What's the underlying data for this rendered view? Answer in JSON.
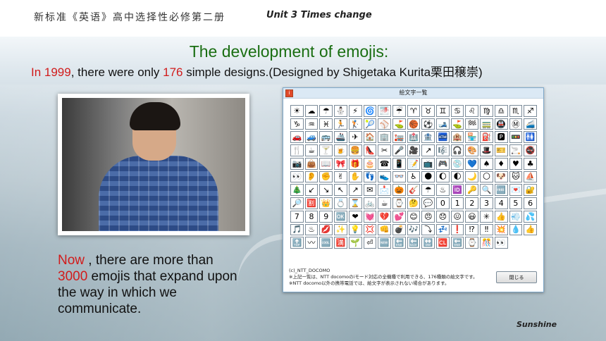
{
  "header": {
    "title": "新标准《英语》高中选择性必修第二册",
    "unit": "Unit 3 Times change"
  },
  "heading": "The development of emojis:",
  "subline": {
    "pre": "In 1999",
    "mid1": ",  there were only ",
    "count": "176",
    "mid2": " simple designs.(Designed by Shigetaka Kurita栗田穣崇)"
  },
  "now": {
    "word": "Now",
    "rest1": " , there are more than",
    "count": "3000",
    "rest2": " emojis that expand upon the way in which we communicate."
  },
  "footer": "Sunshine",
  "window": {
    "title": "絵文字一覧",
    "footnote1": "(c)_NTT_DOCOMO",
    "footnote2": "※上記一覧は、NTT docomoのiモード対応の全機種で利用できる、176種類の絵文字です。",
    "footnote3": "※NTT docomo以外の携帯電話では、絵文字が表示されない場合があります。",
    "close_label": "閉じる",
    "emojis": [
      "☀",
      "☁",
      "☂",
      "⛄",
      "⚡",
      "🌀",
      "🌁",
      "☔",
      "♈",
      "♉",
      "♊",
      "♋",
      "♌",
      "♍",
      "♎",
      "♏",
      "♐",
      "♑",
      "♒",
      "♓",
      "🏃",
      "🏌",
      "🎾",
      "⚾",
      "⛳",
      "🏀",
      "⚽",
      "🎿",
      "⛳",
      "🏁",
      "🚃",
      "🚇",
      "Ⓜ",
      "🚄",
      "🚗",
      "🚙",
      "🚌",
      "🚢",
      "✈",
      "🏠",
      "🏢",
      "🏣",
      "🏥",
      "🏦",
      "🏧",
      "🏨",
      "🏪",
      "⛽",
      "🅿",
      "🚥",
      "🚻",
      "🍴",
      "☕",
      "🍸",
      "🍺",
      "🍔",
      "👠",
      "✂",
      "🎤",
      "🎥",
      "↗",
      "🎼",
      "🎧",
      "🎨",
      "🎩",
      "🎫",
      "🚬",
      "🚭",
      "📷",
      "👜",
      "📖",
      "🎀",
      "🎁",
      "🎂",
      "☎",
      "📱",
      "📝",
      "📺",
      "🎮",
      "💿",
      "💙",
      "♠",
      "♦",
      "♥",
      "♣",
      "👀",
      "👂",
      "✊",
      "✌",
      "✋",
      "👣",
      "👟",
      "👓",
      "♿",
      "🌑",
      "🌔",
      "🌓",
      "🌙",
      "🌕",
      "🐶",
      "🐱",
      "⛵",
      "🎄",
      "↙",
      "↘",
      "↖",
      "↗",
      "✉",
      "📩",
      "🎃",
      "🎸",
      "☂",
      "♨",
      "🆔",
      "🔑",
      "🔍",
      "🆓",
      "💌",
      "🔐",
      "🔎",
      "🈹",
      "👑",
      "💍",
      "⌛",
      "🚲",
      "☕",
      "⌚",
      "🤔",
      "💬",
      "0",
      "1",
      "2",
      "3",
      "4",
      "5",
      "6",
      "7",
      "8",
      "9",
      "🆗",
      "❤",
      "💓",
      "💔",
      "💕",
      "😊",
      "😠",
      "😞",
      "😖",
      "😃",
      "✳",
      "👍",
      "💨",
      "💦",
      "🎵",
      "♨",
      "💋",
      "✨",
      "💡",
      "💢",
      "👊",
      "💣",
      "🎶",
      "⤵",
      "💤",
      "❗",
      "⁉",
      "‼",
      "💥",
      "💧",
      "👍",
      "🔝",
      "〰",
      "🆒",
      "🈵",
      "🌱",
      "⏎",
      "🆕",
      "🔚",
      "🔙",
      "🔛",
      "🆑",
      "🔚",
      "⌚",
      "🎊",
      "👀"
    ]
  }
}
